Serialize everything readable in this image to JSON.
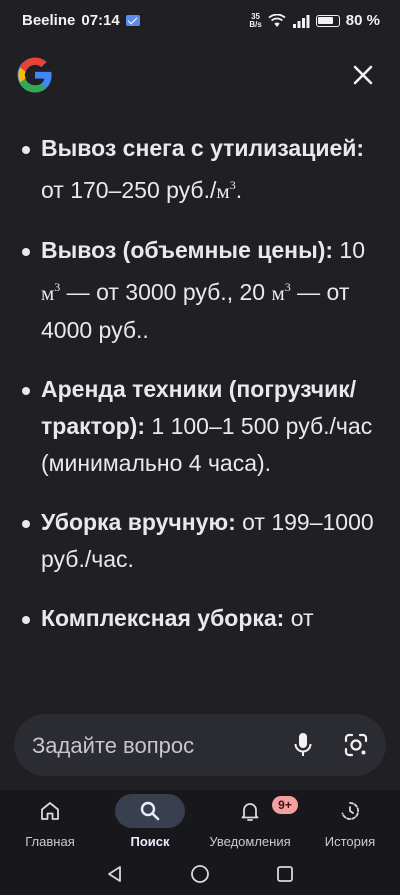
{
  "status_bar": {
    "carrier": "Beeline",
    "time": "07:14",
    "net_speed_value": "35",
    "net_speed_unit": "B/s",
    "battery": "80 %",
    "battery_level": 0.8
  },
  "header": {
    "logo_icon": "google-g-icon",
    "close_icon": "close-icon"
  },
  "content": {
    "items": [
      {
        "label": "Вывоз снега с утилизацией:",
        "text_before": " от 170–250 руб./",
        "unit": "м",
        "unit_sup": "3",
        "text_after": "."
      },
      {
        "label": "Вывоз (объемные цены):",
        "text1": " 10 ",
        "unit1": "м",
        "unit1_sup": "3",
        "text2": " — от 3000 руб., 20 ",
        "unit2": "м",
        "unit2_sup": "3",
        "text3": " — от 4000 руб.."
      },
      {
        "label": "Аренда техники (погрузчик/трактор):",
        "text": " 1 100–1 500 руб./час (минимально 4 часа)."
      },
      {
        "label": "Уборка вручную:",
        "text": " от 199–1000 руб./час."
      },
      {
        "label": "Комплексная уборка:",
        "text": " от"
      }
    ]
  },
  "search": {
    "placeholder": "Задайте вопрос",
    "mic_icon": "microphone-icon",
    "lens_icon": "lens-camera-icon"
  },
  "bottom_nav": {
    "items": [
      {
        "label": "Главная",
        "icon": "home-icon"
      },
      {
        "label": "Поиск",
        "icon": "search-icon",
        "active": true
      },
      {
        "label": "Уведомления",
        "icon": "bell-icon",
        "badge": "9+"
      },
      {
        "label": "История",
        "icon": "history-icon"
      }
    ]
  },
  "colors": {
    "background": "#1f1f24",
    "text": "#e8e8ee",
    "search_field": "#2b2b32",
    "nav_active": "#3a3f4f",
    "badge": "#f2a0a0"
  }
}
